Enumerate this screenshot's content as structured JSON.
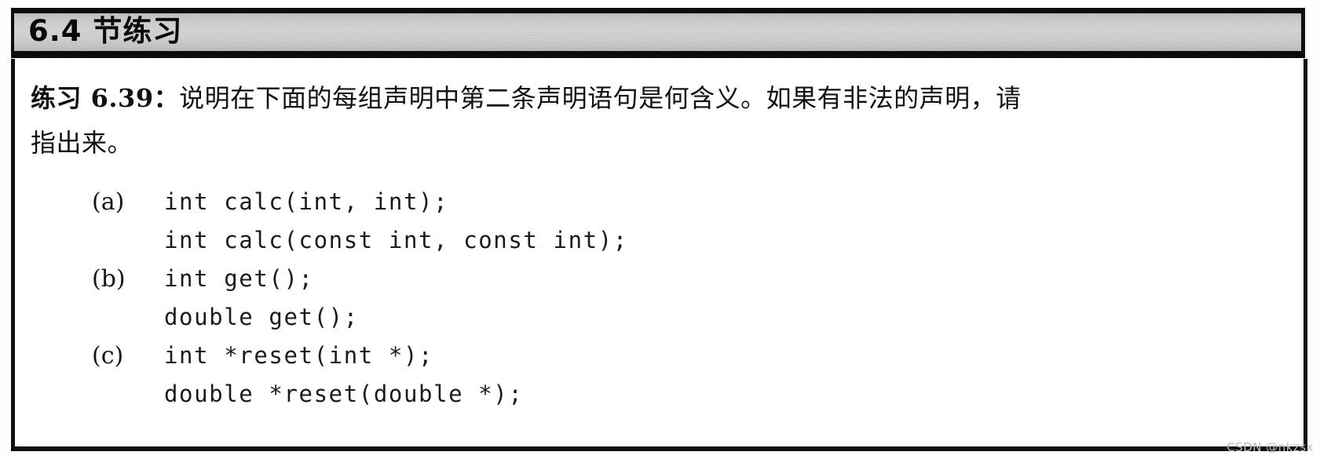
{
  "section": {
    "header_title": "6.4 节练习"
  },
  "exercise": {
    "label": "练习 6.39：",
    "line1_rest": "说明在下面的每组声明中第二条声明语句是何含义。如果有非法的声明，请",
    "line2": "指出来。"
  },
  "code_listing": [
    {
      "label": "(a)",
      "code": "int calc(int, int);"
    },
    {
      "label": "",
      "code": "int calc(const int, const int);"
    },
    {
      "label": "(b)",
      "code": "int get();"
    },
    {
      "label": "",
      "code": "double get();"
    },
    {
      "label": "(c)",
      "code": "int *reset(int *);"
    },
    {
      "label": "",
      "code": "double *reset(double *);"
    }
  ],
  "watermark": {
    "text": "CSDN @nkzsx"
  },
  "colors": {
    "border": "#101010",
    "header_gray_light": "#d2d2d2",
    "header_gray_dark": "#b4b4b4",
    "text": "#121212",
    "watermark": "#bdbdbd"
  }
}
